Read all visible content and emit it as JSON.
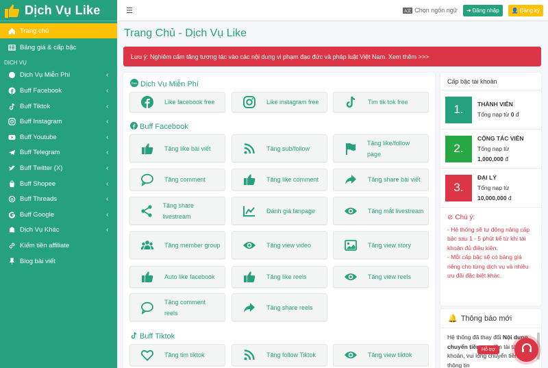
{
  "brand": {
    "name": "Dịch Vụ Like"
  },
  "sidebar": {
    "header": "DỊCH VỤ",
    "items": [
      {
        "label": "Trang chủ",
        "icon": "home-icon",
        "active": true,
        "chevron": false
      },
      {
        "label": "Bảng giá & cấp bậc",
        "icon": "table-icon",
        "chevron": false
      },
      {
        "label": "Dịch Vụ Miễn Phí",
        "icon": "free-icon",
        "chevron": true
      },
      {
        "label": "Buff Facebook",
        "icon": "facebook-icon",
        "chevron": true
      },
      {
        "label": "Buff Tiktok",
        "icon": "tiktok-icon",
        "chevron": true
      },
      {
        "label": "Buff Instagram",
        "icon": "instagram-icon",
        "chevron": true
      },
      {
        "label": "Buff Youtube",
        "icon": "youtube-icon",
        "chevron": true
      },
      {
        "label": "Buff Telegram",
        "icon": "telegram-icon",
        "chevron": true
      },
      {
        "label": "Buff Twitter (X)",
        "icon": "twitter-icon",
        "chevron": true
      },
      {
        "label": "Buff Shopee",
        "icon": "shopee-icon",
        "chevron": true
      },
      {
        "label": "Buff Threads",
        "icon": "threads-icon",
        "chevron": true
      },
      {
        "label": "Buff Google",
        "icon": "google-icon",
        "chevron": true
      },
      {
        "label": "Dịch Vụ Khác",
        "icon": "other-icon",
        "chevron": true
      },
      {
        "label": "Kiếm tiền affiliate",
        "icon": "link-icon",
        "chevron": false
      },
      {
        "label": "Blog bài viết",
        "icon": "pin-icon",
        "chevron": false
      }
    ]
  },
  "topbar": {
    "language": "Chọn ngôn ngữ",
    "login": "Đăng nhập",
    "register": "Đăng ký"
  },
  "page_title": "Trang Chủ - Dịch Vụ Like",
  "alert": "Lưu ý: Nghiêm cấm tăng tương tác vào các nội dung vi phạm đạo đức và pháp luật Việt Nam. Xem thêm >>>",
  "sections": [
    {
      "title": "Dịch Vụ Miễn Phí",
      "icon": "free-badge-icon",
      "cards": [
        {
          "label": "Like facebook free",
          "icon": "facebook-icon"
        },
        {
          "label": "Like instagram free",
          "icon": "instagram-icon"
        },
        {
          "label": "Tim tik tok free",
          "icon": "tiktok-icon"
        }
      ]
    },
    {
      "title": "Buff Facebook",
      "icon": "facebook-icon",
      "cards": [
        {
          "label": "Tăng like bài viết",
          "icon": "thumbs-up-icon"
        },
        {
          "label": "Tăng sub/follow",
          "icon": "rss-icon"
        },
        {
          "label": "Tăng like/follow page",
          "icon": "flag-icon"
        },
        {
          "label": "Tăng comment",
          "icon": "comment-icon"
        },
        {
          "label": "Tăng like comment",
          "icon": "thumbs-up-icon"
        },
        {
          "label": "Tăng share bài viết",
          "icon": "share-icon"
        },
        {
          "label": "Tăng share livestream",
          "icon": "share-nodes-icon"
        },
        {
          "label": "Đánh giá fanpage",
          "icon": "chart-line-icon"
        },
        {
          "label": "Tăng mắt livestream",
          "icon": "eye-icon"
        },
        {
          "label": "Tăng member group",
          "icon": "users-icon"
        },
        {
          "label": "Tăng view video",
          "icon": "eye-icon"
        },
        {
          "label": "Tăng view story",
          "icon": "image-icon"
        },
        {
          "label": "Auto like facebook",
          "icon": "thumbs-up-icon"
        },
        {
          "label": "Tăng like reels",
          "icon": "thumbs-up-icon"
        },
        {
          "label": "Tăng view reels",
          "icon": "eye-icon"
        },
        {
          "label": "Tăng comment reels",
          "icon": "comment-icon"
        },
        {
          "label": "Tăng share reels",
          "icon": "share-icon"
        }
      ]
    },
    {
      "title": "Buff Tiktok",
      "icon": "tiktok-icon",
      "cards": [
        {
          "label": "Tăng tim tiktok",
          "icon": "heart-icon"
        },
        {
          "label": "Tăng follow Tiktok",
          "icon": "rss-icon"
        },
        {
          "label": "Tăng view tiktok",
          "icon": "eye-icon"
        }
      ]
    }
  ],
  "rank": {
    "title": "Cấp bậc tài khoản",
    "items": [
      {
        "num": "1.",
        "name": "THÀNH VIÊN",
        "deposit_label": "Tổng nạp từ",
        "amount": "0",
        "currency": "đ",
        "color": "#26a17d"
      },
      {
        "num": "2.",
        "name": "CỘNG TÁC VIÊN",
        "deposit_label": "Tổng nạp từ",
        "amount": "1,000,000",
        "currency": "đ",
        "color": "#28a745"
      },
      {
        "num": "3.",
        "name": "ĐẠI LÝ",
        "deposit_label": "Tổng nạp từ",
        "amount": "10,000,000",
        "currency": "đ",
        "color": "#dc3545"
      }
    ],
    "note_title": "Chú ý:",
    "notes": [
      "- Hệ thống sẽ tự động nâng cấp bậc sau 1 - 5 phút kể từ khi tài khoản đủ điều kiện.",
      "- Mỗi cấp bậc sẽ có bảng giá riêng cho từng dịch vụ và nhiều ưu đãi đặc biệt khác."
    ]
  },
  "notify": {
    "title": "Thông báo mới",
    "body_prefix": "Hệ thống đã thay đổi ",
    "body_bold": "Nội dung chuyển tiền",
    "body_rest": " nạp tiền tài tài khoản, vui lòng chuyển tiền đúng thông tin"
  },
  "support": {
    "label": "Hỗ trợ"
  },
  "colors": {
    "primary": "#26a17d",
    "warning": "#ffc107",
    "danger": "#dc3545"
  }
}
